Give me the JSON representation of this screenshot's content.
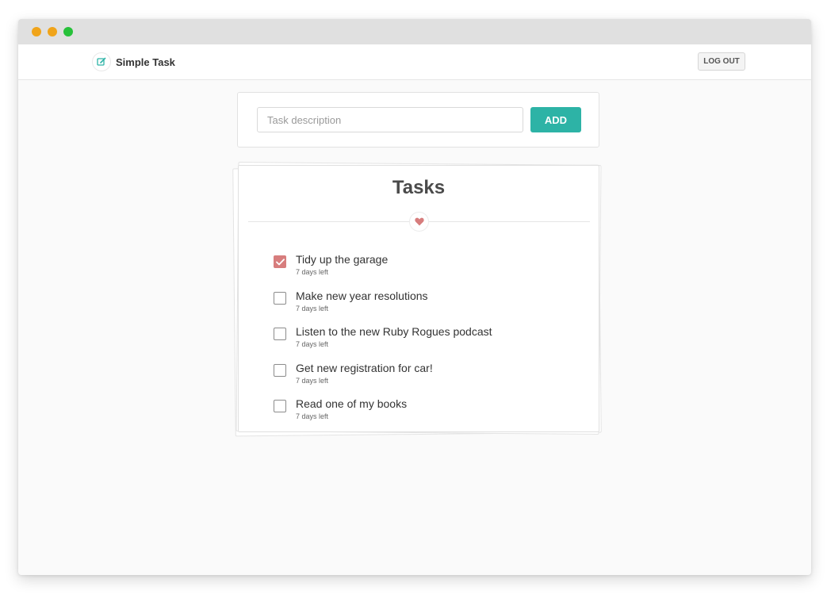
{
  "app": {
    "title": "Simple Task",
    "logout_label": "LOG OUT",
    "accent_color": "#2db3a6",
    "check_color": "#d77d7d"
  },
  "new_task": {
    "placeholder": "Task description",
    "value": "",
    "add_label": "ADD"
  },
  "tasks": {
    "heading": "Tasks",
    "items": [
      {
        "label": "Tidy up the garage",
        "due": "7 days left",
        "done": true
      },
      {
        "label": "Make new year resolutions",
        "due": "7 days left",
        "done": false
      },
      {
        "label": "Listen to the new Ruby Rogues podcast",
        "due": "7 days left",
        "done": false
      },
      {
        "label": "Get new registration for car!",
        "due": "7 days left",
        "done": false
      },
      {
        "label": "Read one of my books",
        "due": "7 days left",
        "done": false
      }
    ]
  },
  "icons": {
    "brand": "edit-icon",
    "divider": "heart-icon",
    "check": "check-icon"
  }
}
